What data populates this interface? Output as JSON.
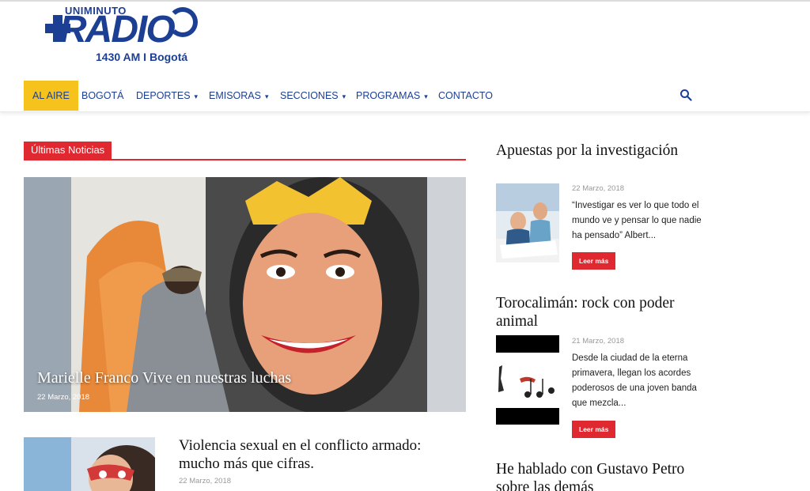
{
  "logo": {
    "top_word": "UNIMINUTO",
    "main_word": "RADIO",
    "tagline": "1430 AM I Bogotá"
  },
  "nav": {
    "items": [
      {
        "label": "AL AIRE",
        "dropdown": false,
        "active": true
      },
      {
        "label": "BOGOTÁ",
        "dropdown": false
      },
      {
        "label": "DEPORTES",
        "dropdown": true
      },
      {
        "label": "EMISORAS",
        "dropdown": true
      },
      {
        "label": "SECCIONES",
        "dropdown": true
      },
      {
        "label": "PROGRAMAS",
        "dropdown": true
      },
      {
        "label": "CONTACTO",
        "dropdown": false
      }
    ],
    "search_icon": "search-icon",
    "chevron": "⌄"
  },
  "colors": {
    "brand_blue": "#1c3f94",
    "accent_yellow": "#f6c21c",
    "accent_red": "#e02830"
  },
  "main": {
    "section_label": "Últimas Noticias",
    "featured": {
      "title": "Marielle Franco Vive en nuestras luchas",
      "date": "22 Marzo, 2018"
    },
    "articles": [
      {
        "title": "Violencia sexual en el conflicto armado: mucho más que cifras.",
        "date": "22 Marzo, 2018"
      }
    ]
  },
  "sidebar": {
    "posts": [
      {
        "title": "Apuestas por la investigación",
        "date": "22 Marzo, 2018",
        "excerpt": "“Investigar es ver lo que todo el mundo ve y pensar lo que nadie ha pensado” Albert...",
        "button": "Leer más"
      },
      {
        "title": "Torocalimán: rock con poder animal",
        "date": "21 Marzo, 2018",
        "excerpt": "  Desde la ciudad de la eterna primavera, llegan los acordes poderosos de una joven banda que mezcla...",
        "button": "Leer más"
      },
      {
        "title": "He hablado con Gustavo Petro sobre las demás"
      }
    ]
  }
}
